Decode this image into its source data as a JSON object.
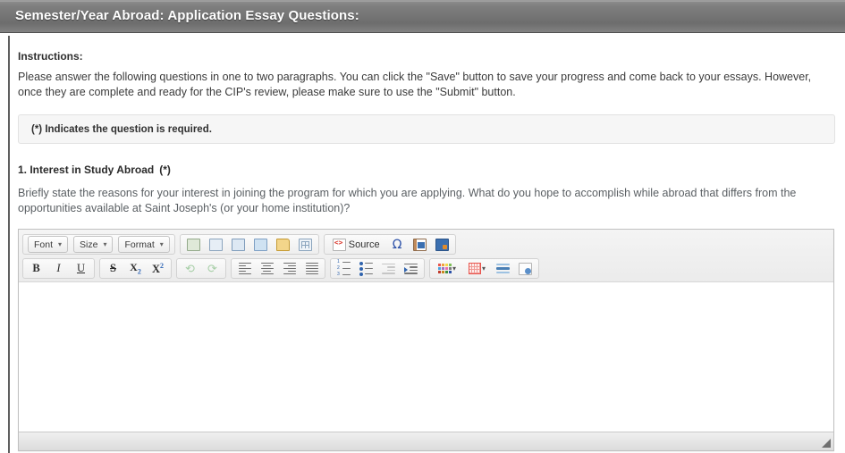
{
  "titlebar": {
    "title": "Semester/Year Abroad: Application Essay Questions:"
  },
  "instructions": {
    "heading": "Instructions:",
    "body": "Please answer the following questions in one to two paragraphs. You can click the \"Save\" button to save your progress and come back to your essays. However, once they are complete and ready for the CIP's review, please make sure to use the \"Submit\" button."
  },
  "required_notice": {
    "text": "(*) Indicates the question is required."
  },
  "question": {
    "number_and_title": "1. Interest in Study Abroad",
    "required_marker": "(*)",
    "prompt": "Briefly state the reasons for your interest in joining the program for which you are applying. What do you hope to accomplish while abroad that differs from the opportunities available at Saint Joseph's (or your home institution)?"
  },
  "editor": {
    "content": "",
    "toolbar_row1": {
      "combos": [
        {
          "label": "Font",
          "icon": "chevron-down-icon"
        },
        {
          "label": "Size",
          "icon": "chevron-down-icon"
        },
        {
          "label": "Format",
          "icon": "chevron-down-icon"
        }
      ],
      "insert_buttons": [
        {
          "name": "link-icon"
        },
        {
          "name": "unlink-icon"
        },
        {
          "name": "anchor-icon"
        },
        {
          "name": "image-icon"
        },
        {
          "name": "file-browser-icon"
        },
        {
          "name": "table-icon"
        }
      ],
      "source_group": [
        {
          "name": "source-icon",
          "label": "Source"
        },
        {
          "name": "special-character-icon",
          "label": "Ω"
        },
        {
          "name": "document-image-icon",
          "label": ""
        },
        {
          "name": "templates-icon",
          "label": ""
        }
      ]
    },
    "toolbar_row2": {
      "basic_styles": [
        {
          "name": "bold-icon",
          "label": "B"
        },
        {
          "name": "italic-icon",
          "label": "I"
        },
        {
          "name": "underline-icon",
          "label": "U"
        }
      ],
      "extra_styles": [
        {
          "name": "strikethrough-icon",
          "label": "S"
        },
        {
          "name": "subscript-icon",
          "label": "X"
        },
        {
          "name": "superscript-icon",
          "label": "X"
        }
      ],
      "history": [
        {
          "name": "undo-icon",
          "disabled": true
        },
        {
          "name": "redo-icon",
          "disabled": true
        }
      ],
      "alignment": [
        {
          "name": "align-left-icon"
        },
        {
          "name": "align-center-icon"
        },
        {
          "name": "align-right-icon"
        },
        {
          "name": "align-justify-icon"
        }
      ],
      "lists": [
        {
          "name": "numbered-list-icon",
          "disabled": false
        },
        {
          "name": "bulleted-list-icon",
          "disabled": false
        },
        {
          "name": "outdent-icon",
          "disabled": true
        },
        {
          "name": "indent-icon",
          "disabled": false
        }
      ],
      "colors_misc": [
        {
          "name": "text-color-icon"
        },
        {
          "name": "background-color-icon"
        },
        {
          "name": "horizontal-rule-icon"
        },
        {
          "name": "page-break-icon"
        }
      ]
    },
    "resize_handle": "resize-grip-icon"
  },
  "colors": {
    "titlebar_gradient_start": "#8d8d8d",
    "titlebar_gradient_end": "#6d6d6d",
    "title_text": "#ffffff",
    "body_text": "#3b3b3b",
    "prompt_text": "#5a5f63",
    "notice_background": "#f6f6f6",
    "notice_border": "#e2e2e2",
    "editor_border": "#c0c0c0",
    "toolbar_background": "#eeeeee",
    "accent_red": "#d9372b",
    "accent_blue": "#2b50a8"
  }
}
